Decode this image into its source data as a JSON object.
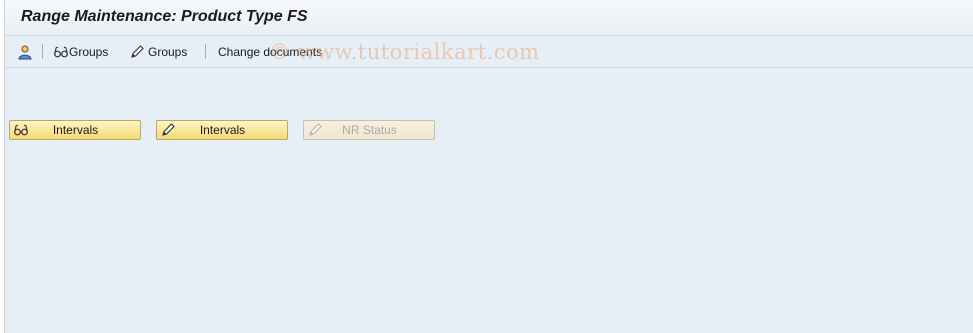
{
  "window": {
    "title": "Range Maintenance: Product Type FS"
  },
  "toolbar": {
    "items": [
      {
        "icon": "user-icon"
      },
      {
        "icon": "glasses-icon",
        "label": "Groups"
      },
      {
        "icon": "pencil-icon",
        "label": "Groups"
      },
      {
        "label": "Change documents"
      }
    ]
  },
  "buttons": [
    {
      "icon": "glasses-icon",
      "label": "Intervals",
      "enabled": true
    },
    {
      "icon": "pencil-icon",
      "label": "Intervals",
      "enabled": true
    },
    {
      "icon": "pencil-icon",
      "label": "NR Status",
      "enabled": false
    }
  ],
  "watermark": "© www.tutorialkart.com",
  "colors": {
    "background": "#e6eef6",
    "button": "#f4db74",
    "button_border": "#b9a766"
  }
}
